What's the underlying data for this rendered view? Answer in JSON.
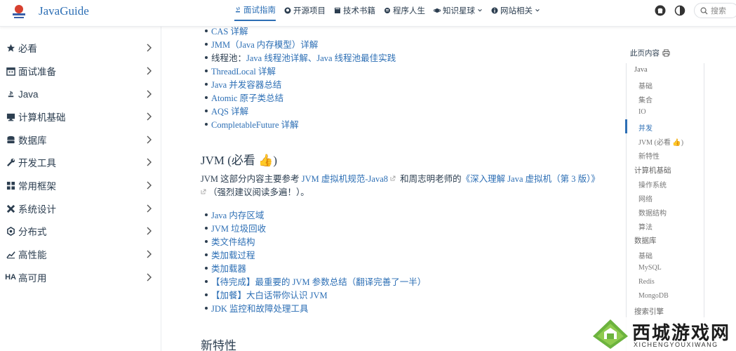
{
  "header": {
    "brand": "JavaGuide",
    "nav": [
      {
        "label": "面试指南",
        "icon": "java-icon",
        "active": true
      },
      {
        "label": "开源项目",
        "icon": "github-icon"
      },
      {
        "label": "技术书籍",
        "icon": "book-icon"
      },
      {
        "label": "程序人生",
        "icon": "article-icon"
      },
      {
        "label": "知识星球",
        "icon": "planet-icon",
        "dropdown": true
      },
      {
        "label": "网站相关",
        "icon": "info-icon",
        "dropdown": true
      }
    ],
    "search_placeholder": "搜索"
  },
  "sidebar": {
    "items": [
      {
        "label": "必看",
        "icon": "star-icon"
      },
      {
        "label": "面试准备",
        "icon": "calendar-icon"
      },
      {
        "label": "Java",
        "icon": "java-icon"
      },
      {
        "label": "计算机基础",
        "icon": "computer-icon"
      },
      {
        "label": "数据库",
        "icon": "database-icon"
      },
      {
        "label": "开发工具",
        "icon": "wrench-icon"
      },
      {
        "label": "常用框架",
        "icon": "grid-icon"
      },
      {
        "label": "系统设计",
        "icon": "design-icon"
      },
      {
        "label": "分布式",
        "icon": "network-icon"
      },
      {
        "label": "高性能",
        "icon": "chart-icon"
      },
      {
        "label": "高可用",
        "icon": "ha-icon",
        "icon_text": "HA"
      }
    ]
  },
  "main": {
    "top_list": [
      {
        "text": "CAS 详解"
      },
      {
        "text": "JMM（Java 内存模型）详解"
      },
      {
        "prefix": "线程池：",
        "text": "Java 线程池详解、Java 线程池最佳实践"
      },
      {
        "text": "ThreadLocal 详解"
      },
      {
        "text": "Java 并发容器总结"
      },
      {
        "text": "Atomic 原子类总结"
      },
      {
        "text": "AQS 详解"
      },
      {
        "text": "CompletableFuture 详解"
      }
    ],
    "jvm_heading": "JVM (必看 👍)",
    "jvm_para": {
      "t1": "JVM 这部分内容主要参考 ",
      "link1": "JVM 虚拟机规范-Java8",
      "t2": " 和周志明老师的",
      "link2": "《深入理解 Java 虚拟机（第 3 版）》",
      "t3": "（强烈建议阅读多遍！）。"
    },
    "jvm_list": [
      "Java 内存区域",
      "JVM 垃圾回收",
      "类文件结构",
      "类加载过程",
      "类加载器",
      "【待完成】最重要的 JVM 参数总结（翻译完善了一半）",
      "【加餐】大白话带你认识 JVM",
      "JDK 监控和故障处理工具"
    ],
    "next_heading": "新特性"
  },
  "toc": {
    "title": "此页内容",
    "items": [
      {
        "label": "Java",
        "level": 1
      },
      {
        "label": "基础",
        "level": 2
      },
      {
        "label": "集合",
        "level": 2
      },
      {
        "label": "IO",
        "level": 2
      },
      {
        "label": "并发",
        "level": 2,
        "active": true
      },
      {
        "label": "JVM (必看 👍)",
        "level": 2
      },
      {
        "label": "新特性",
        "level": 2
      },
      {
        "label": "计算机基础",
        "level": 1
      },
      {
        "label": "操作系统",
        "level": 2
      },
      {
        "label": "网络",
        "level": 2
      },
      {
        "label": "数据结构",
        "level": 2
      },
      {
        "label": "算法",
        "level": 2
      },
      {
        "label": "数据库",
        "level": 1
      },
      {
        "label": "基础",
        "level": 2
      },
      {
        "label": "MySQL",
        "level": 2
      },
      {
        "label": "Redis",
        "level": 2
      },
      {
        "label": "MongoDB",
        "level": 2
      },
      {
        "label": "搜索引擎",
        "level": 1
      }
    ]
  },
  "watermark": {
    "title": "西城游戏网",
    "subtitle": "XICHENGYOUXIWANG"
  }
}
